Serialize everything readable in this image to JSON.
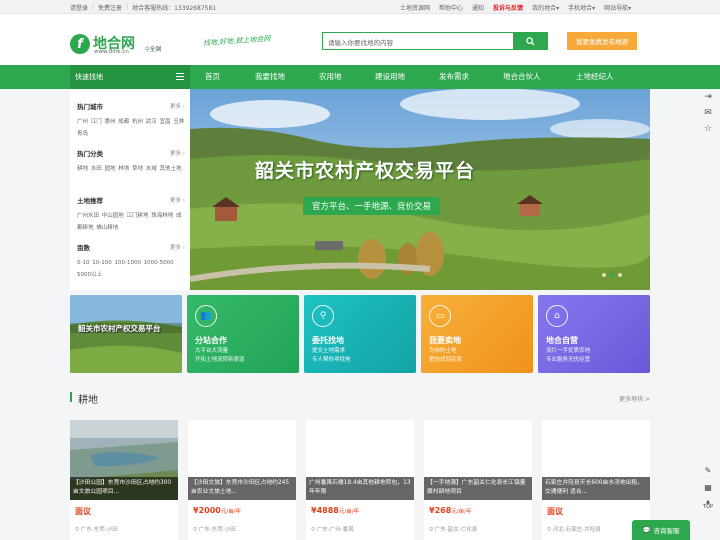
{
  "topbar": {
    "login": "请登录",
    "register": "免费注册",
    "hotline": "地合客服热线：13392687581",
    "right_links": [
      "土地资源网",
      "帮助中心",
      "通知",
      "投诉与反馈",
      "我的地合",
      "手机地合",
      "网站导航"
    ]
  },
  "header": {
    "logo_mark": "f",
    "logo_text": "地合网",
    "logo_url": "www.dihe.cn",
    "city": "全国",
    "slogan": "找地,好地,就上地合网",
    "search_placeholder": "请输入你要找地的内容",
    "publish_button": "我要免费发布地源"
  },
  "nav": {
    "quick": "快速找地",
    "items": [
      "首页",
      "我要找地",
      "农用地",
      "建设用地",
      "发布需求",
      "地合合伙人",
      "土地经纪人"
    ]
  },
  "sidebar": {
    "more": "更多",
    "groups": [
      {
        "title": "热门城市",
        "links": "广州  江门  惠州  成都  杭州  武汉  宜昌  玉林  青岛"
      },
      {
        "title": "热门分类",
        "links": "耕地  水田  园地  林地  草地  水域  其他土地"
      },
      {
        "title": "土地推荐",
        "links": "广州水田  中山园地  江门耕地  珠海林地  成都耕地  佛山耕地"
      },
      {
        "title": "亩数",
        "links": "0-10  10-100  100-1000  1000-5000  5000以上"
      }
    ]
  },
  "banner": {
    "title": "韶关市农村产权交易平台",
    "subtitle": "官方平台、一手地源、竞价交易"
  },
  "cards": [
    {
      "title": "",
      "desc": "",
      "color": "#4a8a3a",
      "img": true,
      "img_title": "韶关市农村产权交易平台"
    },
    {
      "title": "分站合作",
      "desc": "大平台大流量\n开拓土地流转新渠道",
      "color": "#2fb064",
      "icon": "people-icon"
    },
    {
      "title": "委托找地",
      "desc": "提交土地需求\n专人帮你寻找地",
      "color": "#18b3b3",
      "icon": "search-icon"
    },
    {
      "title": "我要卖地",
      "desc": "为你的土地\n把快找到买家",
      "color": "#f3a12b",
      "icon": "sell-icon"
    },
    {
      "title": "地合自营",
      "desc": "流片一手优质农地\n专业服务无忧经营",
      "color": "#7a6be6",
      "icon": "factory-icon"
    }
  ],
  "section": {
    "title": "耕地",
    "more": "更多地块 >"
  },
  "lands": [
    {
      "caption": "【沙田公园】东莞市沙田区占地约300亩文旅公园项目...",
      "price": "面议",
      "unit": "",
      "loc": "广东-东莞-沙田"
    },
    {
      "caption": "【沙田文旅】东莞市沙田区占地约245亩农业文旅土地...",
      "price": "¥2000",
      "unit": "元/亩/年",
      "loc": "广东-东莞-沙田"
    },
    {
      "caption": "广州番禺石楼18.4亩其他耕地转包，13年年限",
      "price": "¥4888",
      "unit": "元/亩/年",
      "loc": "广东-广州-番禺"
    },
    {
      "caption": "【一手地源】广东韶关仁化县长江镇量属村耕地项目",
      "price": "¥268",
      "unit": "元/亩/年",
      "loc": "广东-韶关-仁化县"
    },
    {
      "caption": "石家庄井陉县天长600亩水浇地出租，交通便利 适合...",
      "price": "面议",
      "unit": "",
      "loc": "河北-石家庄-井陉县"
    }
  ],
  "right_tools": {
    "top_label": "TOP"
  },
  "chat": {
    "label": "咨询客服"
  }
}
